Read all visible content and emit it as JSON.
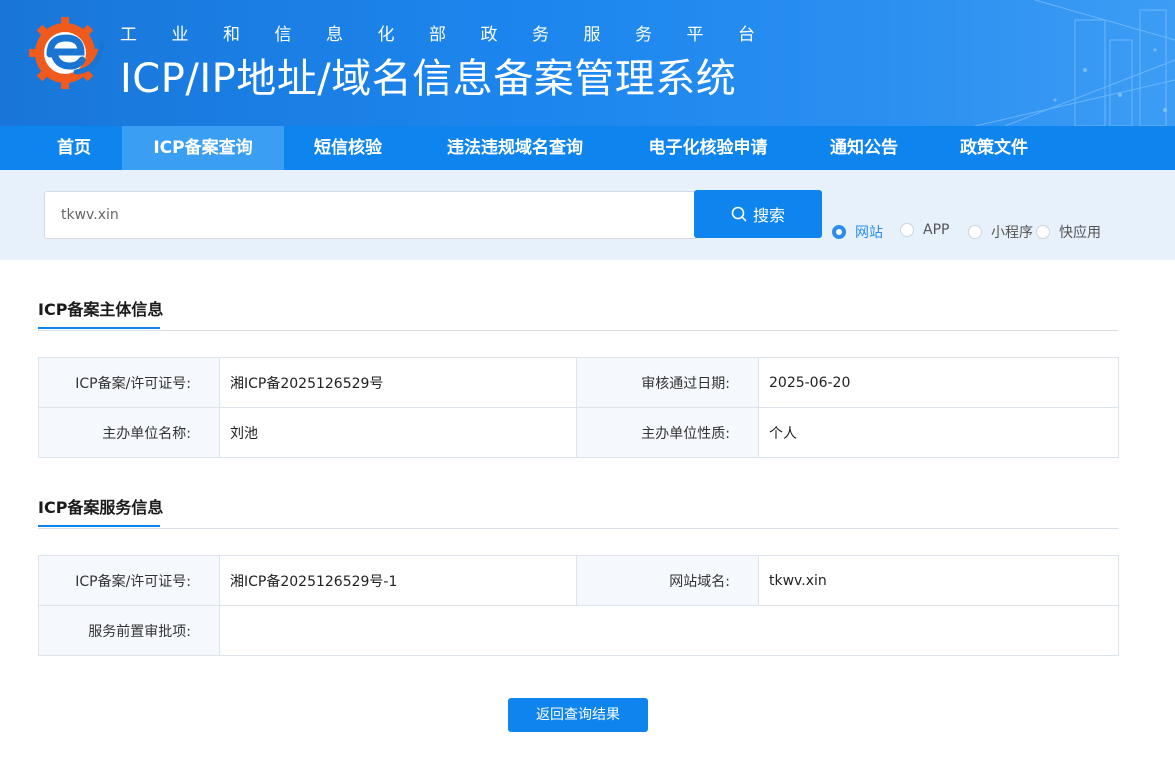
{
  "header": {
    "subtitle": "工业和信息化部政务服务平台",
    "title": "ICP/IP地址/域名信息备案管理系统",
    "logo_icon": "gear-e-logo-icon"
  },
  "nav": {
    "items": [
      {
        "label": "首页",
        "active": false
      },
      {
        "label": "ICP备案查询",
        "active": true
      },
      {
        "label": "短信核验",
        "active": false
      },
      {
        "label": "违法违规域名查询",
        "active": false
      },
      {
        "label": "电子化核验申请",
        "active": false
      },
      {
        "label": "通知公告",
        "active": false
      },
      {
        "label": "政策文件",
        "active": false
      }
    ]
  },
  "search": {
    "value": "tkwv.xin",
    "button_label": "搜索",
    "button_icon": "search-icon",
    "types": [
      {
        "label": "网站",
        "checked": true
      },
      {
        "label": "APP",
        "checked": false
      },
      {
        "label": "小程序",
        "checked": false
      },
      {
        "label": "快应用",
        "checked": false
      }
    ]
  },
  "subject_info": {
    "title": "ICP备案主体信息",
    "rows": [
      {
        "label1": "ICP备案/许可证号:",
        "value1": "湘ICP备2025126529号",
        "label2": "审核通过日期:",
        "value2": "2025-06-20"
      },
      {
        "label1": "主办单位名称:",
        "value1": "刘池",
        "label2": "主办单位性质:",
        "value2": "个人"
      }
    ]
  },
  "service_info": {
    "title": "ICP备案服务信息",
    "license_label": "ICP备案/许可证号:",
    "license_value": "湘ICP备2025126529号-1",
    "domain_label": "网站域名:",
    "domain_value": "tkwv.xin",
    "approval_label": "服务前置审批项:",
    "approval_value": ""
  },
  "back_button_label": "返回查询结果",
  "colors": {
    "primary": "#0d84ee",
    "nav_active": "#3a9ff2",
    "search_band": "#e6f1fb",
    "radio_checked": "#2d8cf0"
  }
}
